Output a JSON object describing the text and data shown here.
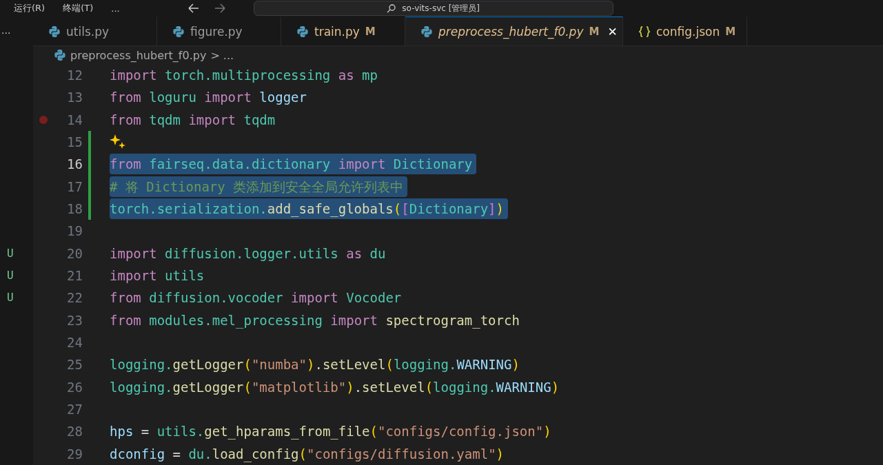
{
  "menu": [
    "运行(R)",
    "终端(T)",
    "..."
  ],
  "command_center": {
    "title": "so-vits-svc [管理员]"
  },
  "sidebar": {
    "more": "..."
  },
  "tabs": [
    {
      "label": "utils.py",
      "kind": "python",
      "selected": false,
      "modified": false,
      "preview": false
    },
    {
      "label": "figure.py",
      "kind": "python",
      "selected": false,
      "modified": false,
      "preview": false
    },
    {
      "label": "train.py",
      "kind": "python",
      "badge": "M",
      "selected": false,
      "modified": true,
      "preview": false
    },
    {
      "label": "preprocess_hubert_f0.py",
      "kind": "python",
      "badge": "M",
      "selected": true,
      "modified": true,
      "preview": true,
      "close": "✕"
    },
    {
      "label": "config.json",
      "kind": "json",
      "badge": "M",
      "selected": false,
      "modified": true,
      "preview": false
    }
  ],
  "breadcrumb": {
    "file": "preprocess_hubert_f0.py",
    "rest": "> ..."
  },
  "lines": [
    {
      "number": "12",
      "current": false,
      "breakpoint": false,
      "added": false,
      "selected": false,
      "sparkle": false,
      "tokens": [
        {
          "kind": "kw",
          "text": "import "
        },
        {
          "kind": "mod",
          "text": "torch.multiprocessing "
        },
        {
          "kind": "kw",
          "text": "as "
        },
        {
          "kind": "mod",
          "text": "mp"
        }
      ]
    },
    {
      "number": "13",
      "current": false,
      "breakpoint": false,
      "added": false,
      "selected": false,
      "sparkle": false,
      "tokens": [
        {
          "kind": "kw",
          "text": "from "
        },
        {
          "kind": "mod",
          "text": "loguru "
        },
        {
          "kind": "kw",
          "text": "import "
        },
        {
          "kind": "var",
          "text": "logger"
        }
      ]
    },
    {
      "number": "14",
      "current": false,
      "breakpoint": true,
      "added": false,
      "selected": false,
      "sparkle": false,
      "tokens": [
        {
          "kind": "kw",
          "text": "from "
        },
        {
          "kind": "mod",
          "text": "tqdm "
        },
        {
          "kind": "kw",
          "text": "import "
        },
        {
          "kind": "mod",
          "text": "tqdm"
        }
      ]
    },
    {
      "number": "15",
      "current": false,
      "breakpoint": false,
      "added": true,
      "selected": false,
      "sparkle": true
    },
    {
      "number": "16",
      "current": true,
      "breakpoint": false,
      "added": true,
      "selected": true,
      "sparkle": false,
      "tokens": [
        {
          "kind": "kw",
          "text": "from "
        },
        {
          "kind": "mod",
          "text": "fairseq.data.dictionary "
        },
        {
          "kind": "kw",
          "text": "import "
        },
        {
          "kind": "mod",
          "text": "Dictionary"
        }
      ]
    },
    {
      "number": "17",
      "current": false,
      "breakpoint": false,
      "added": true,
      "selected": true,
      "sparkle": false,
      "tokens": [
        {
          "kind": "comment",
          "text": "# 将 Dictionary 类添加到安全全局允许列表中"
        }
      ]
    },
    {
      "number": "18",
      "current": false,
      "breakpoint": false,
      "added": true,
      "selected": true,
      "sparkle": false,
      "tokens": [
        {
          "kind": "mod",
          "text": "torch.serialization."
        },
        {
          "kind": "func",
          "text": "add_safe_globals"
        },
        {
          "kind": "paren",
          "text": "("
        },
        {
          "kind": "bracket",
          "text": "["
        },
        {
          "kind": "mod",
          "text": "Dictionary"
        },
        {
          "kind": "bracket",
          "text": "]"
        },
        {
          "kind": "paren",
          "text": ")"
        }
      ]
    },
    {
      "number": "19",
      "current": false,
      "breakpoint": false,
      "added": false,
      "selected": false,
      "sparkle": false
    },
    {
      "number": "20",
      "current": false,
      "breakpoint": false,
      "added": false,
      "selected": false,
      "sparkle": false,
      "status": "U",
      "tokens": [
        {
          "kind": "kw",
          "text": "import "
        },
        {
          "kind": "mod",
          "text": "diffusion.logger.utils "
        },
        {
          "kind": "kw",
          "text": "as "
        },
        {
          "kind": "mod",
          "text": "du"
        }
      ]
    },
    {
      "number": "21",
      "current": false,
      "breakpoint": false,
      "added": false,
      "selected": false,
      "sparkle": false,
      "status": "U",
      "tokens": [
        {
          "kind": "kw",
          "text": "import "
        },
        {
          "kind": "mod",
          "text": "utils"
        }
      ]
    },
    {
      "number": "22",
      "current": false,
      "breakpoint": false,
      "added": false,
      "selected": false,
      "sparkle": false,
      "status": "U",
      "tokens": [
        {
          "kind": "kw",
          "text": "from "
        },
        {
          "kind": "mod",
          "text": "diffusion.vocoder "
        },
        {
          "kind": "kw",
          "text": "import "
        },
        {
          "kind": "mod",
          "text": "Vocoder"
        }
      ]
    },
    {
      "number": "23",
      "current": false,
      "breakpoint": false,
      "added": false,
      "selected": false,
      "sparkle": false,
      "tokens": [
        {
          "kind": "kw",
          "text": "from "
        },
        {
          "kind": "mod",
          "text": "modules.mel_processing "
        },
        {
          "kind": "kw",
          "text": "import "
        },
        {
          "kind": "func",
          "text": "spectrogram_torch"
        }
      ]
    },
    {
      "number": "24",
      "current": false,
      "breakpoint": false,
      "added": false,
      "selected": false,
      "sparkle": false
    },
    {
      "number": "25",
      "current": false,
      "breakpoint": false,
      "added": false,
      "selected": false,
      "sparkle": false,
      "tokens": [
        {
          "kind": "mod",
          "text": "logging."
        },
        {
          "kind": "func",
          "text": "getLogger"
        },
        {
          "kind": "paren",
          "text": "("
        },
        {
          "kind": "str",
          "text": "\"numba\""
        },
        {
          "kind": "paren",
          "text": ")"
        },
        {
          "kind": "plain",
          "text": "."
        },
        {
          "kind": "func",
          "text": "setLevel"
        },
        {
          "kind": "paren",
          "text": "("
        },
        {
          "kind": "mod",
          "text": "logging."
        },
        {
          "kind": "var",
          "text": "WARNING"
        },
        {
          "kind": "paren",
          "text": ")"
        }
      ]
    },
    {
      "number": "26",
      "current": false,
      "breakpoint": false,
      "added": false,
      "selected": false,
      "sparkle": false,
      "tokens": [
        {
          "kind": "mod",
          "text": "logging."
        },
        {
          "kind": "func",
          "text": "getLogger"
        },
        {
          "kind": "paren",
          "text": "("
        },
        {
          "kind": "str",
          "text": "\"matplotlib\""
        },
        {
          "kind": "paren",
          "text": ")"
        },
        {
          "kind": "plain",
          "text": "."
        },
        {
          "kind": "func",
          "text": "setLevel"
        },
        {
          "kind": "paren",
          "text": "("
        },
        {
          "kind": "mod",
          "text": "logging."
        },
        {
          "kind": "var",
          "text": "WARNING"
        },
        {
          "kind": "paren",
          "text": ")"
        }
      ]
    },
    {
      "number": "27",
      "current": false,
      "breakpoint": false,
      "added": false,
      "selected": false,
      "sparkle": false
    },
    {
      "number": "28",
      "current": false,
      "breakpoint": false,
      "added": false,
      "selected": false,
      "sparkle": false,
      "tokens": [
        {
          "kind": "var",
          "text": "hps "
        },
        {
          "kind": "plain",
          "text": "= "
        },
        {
          "kind": "mod",
          "text": "utils."
        },
        {
          "kind": "func",
          "text": "get_hparams_from_file"
        },
        {
          "kind": "paren",
          "text": "("
        },
        {
          "kind": "str",
          "text": "\"configs/config.json\""
        },
        {
          "kind": "paren",
          "text": ")"
        }
      ]
    },
    {
      "number": "29",
      "current": false,
      "breakpoint": false,
      "added": false,
      "selected": false,
      "sparkle": false,
      "tokens": [
        {
          "kind": "var",
          "text": "dconfig "
        },
        {
          "kind": "plain",
          "text": "= "
        },
        {
          "kind": "mod",
          "text": "du."
        },
        {
          "kind": "func",
          "text": "load_config"
        },
        {
          "kind": "paren",
          "text": "("
        },
        {
          "kind": "str",
          "text": "\"configs/diffusion.yaml\""
        },
        {
          "kind": "paren",
          "text": ")"
        }
      ]
    }
  ]
}
